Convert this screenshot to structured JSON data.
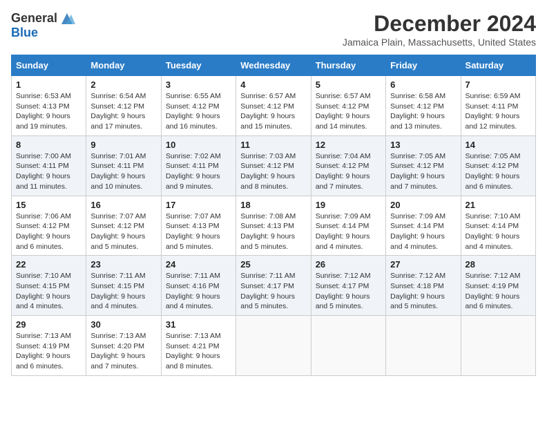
{
  "header": {
    "logo_general": "General",
    "logo_blue": "Blue",
    "month_title": "December 2024",
    "location": "Jamaica Plain, Massachusetts, United States"
  },
  "days_of_week": [
    "Sunday",
    "Monday",
    "Tuesday",
    "Wednesday",
    "Thursday",
    "Friday",
    "Saturday"
  ],
  "weeks": [
    [
      {
        "day": "1",
        "sunrise": "6:53 AM",
        "sunset": "4:13 PM",
        "daylight": "9 hours and 19 minutes."
      },
      {
        "day": "2",
        "sunrise": "6:54 AM",
        "sunset": "4:12 PM",
        "daylight": "9 hours and 17 minutes."
      },
      {
        "day": "3",
        "sunrise": "6:55 AM",
        "sunset": "4:12 PM",
        "daylight": "9 hours and 16 minutes."
      },
      {
        "day": "4",
        "sunrise": "6:57 AM",
        "sunset": "4:12 PM",
        "daylight": "9 hours and 15 minutes."
      },
      {
        "day": "5",
        "sunrise": "6:57 AM",
        "sunset": "4:12 PM",
        "daylight": "9 hours and 14 minutes."
      },
      {
        "day": "6",
        "sunrise": "6:58 AM",
        "sunset": "4:12 PM",
        "daylight": "9 hours and 13 minutes."
      },
      {
        "day": "7",
        "sunrise": "6:59 AM",
        "sunset": "4:11 PM",
        "daylight": "9 hours and 12 minutes."
      }
    ],
    [
      {
        "day": "8",
        "sunrise": "7:00 AM",
        "sunset": "4:11 PM",
        "daylight": "9 hours and 11 minutes."
      },
      {
        "day": "9",
        "sunrise": "7:01 AM",
        "sunset": "4:11 PM",
        "daylight": "9 hours and 10 minutes."
      },
      {
        "day": "10",
        "sunrise": "7:02 AM",
        "sunset": "4:11 PM",
        "daylight": "9 hours and 9 minutes."
      },
      {
        "day": "11",
        "sunrise": "7:03 AM",
        "sunset": "4:12 PM",
        "daylight": "9 hours and 8 minutes."
      },
      {
        "day": "12",
        "sunrise": "7:04 AM",
        "sunset": "4:12 PM",
        "daylight": "9 hours and 7 minutes."
      },
      {
        "day": "13",
        "sunrise": "7:05 AM",
        "sunset": "4:12 PM",
        "daylight": "9 hours and 7 minutes."
      },
      {
        "day": "14",
        "sunrise": "7:05 AM",
        "sunset": "4:12 PM",
        "daylight": "9 hours and 6 minutes."
      }
    ],
    [
      {
        "day": "15",
        "sunrise": "7:06 AM",
        "sunset": "4:12 PM",
        "daylight": "9 hours and 6 minutes."
      },
      {
        "day": "16",
        "sunrise": "7:07 AM",
        "sunset": "4:12 PM",
        "daylight": "9 hours and 5 minutes."
      },
      {
        "day": "17",
        "sunrise": "7:07 AM",
        "sunset": "4:13 PM",
        "daylight": "9 hours and 5 minutes."
      },
      {
        "day": "18",
        "sunrise": "7:08 AM",
        "sunset": "4:13 PM",
        "daylight": "9 hours and 5 minutes."
      },
      {
        "day": "19",
        "sunrise": "7:09 AM",
        "sunset": "4:14 PM",
        "daylight": "9 hours and 4 minutes."
      },
      {
        "day": "20",
        "sunrise": "7:09 AM",
        "sunset": "4:14 PM",
        "daylight": "9 hours and 4 minutes."
      },
      {
        "day": "21",
        "sunrise": "7:10 AM",
        "sunset": "4:14 PM",
        "daylight": "9 hours and 4 minutes."
      }
    ],
    [
      {
        "day": "22",
        "sunrise": "7:10 AM",
        "sunset": "4:15 PM",
        "daylight": "9 hours and 4 minutes."
      },
      {
        "day": "23",
        "sunrise": "7:11 AM",
        "sunset": "4:15 PM",
        "daylight": "9 hours and 4 minutes."
      },
      {
        "day": "24",
        "sunrise": "7:11 AM",
        "sunset": "4:16 PM",
        "daylight": "9 hours and 4 minutes."
      },
      {
        "day": "25",
        "sunrise": "7:11 AM",
        "sunset": "4:17 PM",
        "daylight": "9 hours and 5 minutes."
      },
      {
        "day": "26",
        "sunrise": "7:12 AM",
        "sunset": "4:17 PM",
        "daylight": "9 hours and 5 minutes."
      },
      {
        "day": "27",
        "sunrise": "7:12 AM",
        "sunset": "4:18 PM",
        "daylight": "9 hours and 5 minutes."
      },
      {
        "day": "28",
        "sunrise": "7:12 AM",
        "sunset": "4:19 PM",
        "daylight": "9 hours and 6 minutes."
      }
    ],
    [
      {
        "day": "29",
        "sunrise": "7:13 AM",
        "sunset": "4:19 PM",
        "daylight": "9 hours and 6 minutes."
      },
      {
        "day": "30",
        "sunrise": "7:13 AM",
        "sunset": "4:20 PM",
        "daylight": "9 hours and 7 minutes."
      },
      {
        "day": "31",
        "sunrise": "7:13 AM",
        "sunset": "4:21 PM",
        "daylight": "9 hours and 8 minutes."
      },
      null,
      null,
      null,
      null
    ]
  ]
}
